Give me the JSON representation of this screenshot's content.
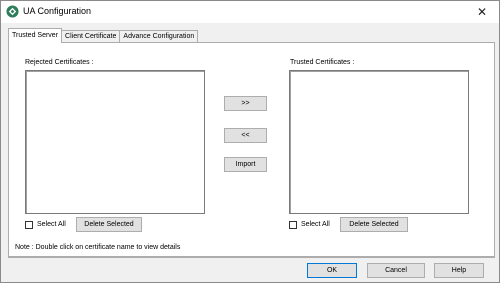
{
  "window": {
    "title": "UA Configuration"
  },
  "tabs": [
    {
      "label": "Trusted Server",
      "active": true
    },
    {
      "label": "Client Certificate",
      "active": false
    },
    {
      "label": "Advance Configuration",
      "active": false
    }
  ],
  "rejected": {
    "label": "Rejected Certificates :",
    "select_all": "Select All",
    "delete_selected": "Delete Selected"
  },
  "trusted": {
    "label": "Trusted Certificates :",
    "select_all": "Select All",
    "delete_selected": "Delete Selected"
  },
  "transfer": {
    "move_right": ">>",
    "move_left": "<<",
    "import": "Import"
  },
  "note": "Note : Double click on certificate name to view details",
  "footer": {
    "ok": "OK",
    "cancel": "Cancel",
    "help": "Help"
  },
  "icons": {
    "app": "ua-app-icon",
    "close": "close-icon"
  }
}
